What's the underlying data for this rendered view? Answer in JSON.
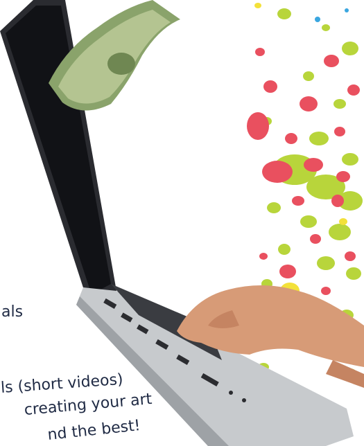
{
  "image": {
    "subjects": [
      "laptop",
      "dollar-bill",
      "typing-hands",
      "paint-splatter"
    ],
    "colors": {
      "splatter_red": "#e9505f",
      "splatter_green": "#b8d53b",
      "splatter_yellow": "#f3e13a",
      "splatter_blue": "#3aa6e0",
      "screen": "#111216",
      "aluminum": "#b9bdc2",
      "bill_green": "#8aa36b",
      "skin": "#d79b77",
      "text": "#1f2a44"
    }
  },
  "text_lines": [
    "als",
    "ls (short videos)",
    "creating your art",
    "nd the best!"
  ]
}
